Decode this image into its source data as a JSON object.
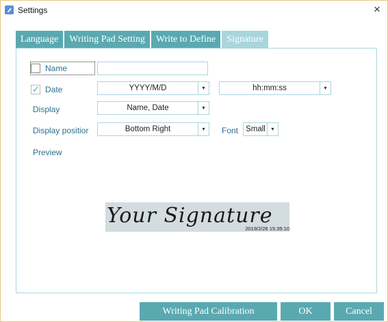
{
  "window": {
    "title": "Settings",
    "close": "×"
  },
  "tabs": [
    {
      "label": "Language"
    },
    {
      "label": "Writing Pad Setting"
    },
    {
      "label": "Write to Define"
    },
    {
      "label": "Signature"
    }
  ],
  "signature": {
    "name": {
      "label": "Name",
      "checked": false,
      "value": ""
    },
    "date": {
      "label": "Date",
      "checked": true,
      "date_format": "YYYY/M/D",
      "time_format": "hh:mm:ss"
    },
    "display": {
      "label": "Display",
      "value": "Name, Date"
    },
    "display_position": {
      "label": "Display positior",
      "value": "Bottom Right"
    },
    "font": {
      "label": "Font",
      "value": "Small"
    },
    "preview": {
      "label": "Preview",
      "signature_text": "Your Signature",
      "timestamp": "2019/2/26 15:35:10"
    }
  },
  "footer": {
    "calibrate_label": "Writing Pad Calibration",
    "ok_label": "OK",
    "cancel_label": "Cancel"
  },
  "colors": {
    "accent": "#5aa9b1",
    "accent_light": "#a8d6db",
    "label_text": "#2b6f8f",
    "preview_bg": "#d3dcde"
  }
}
